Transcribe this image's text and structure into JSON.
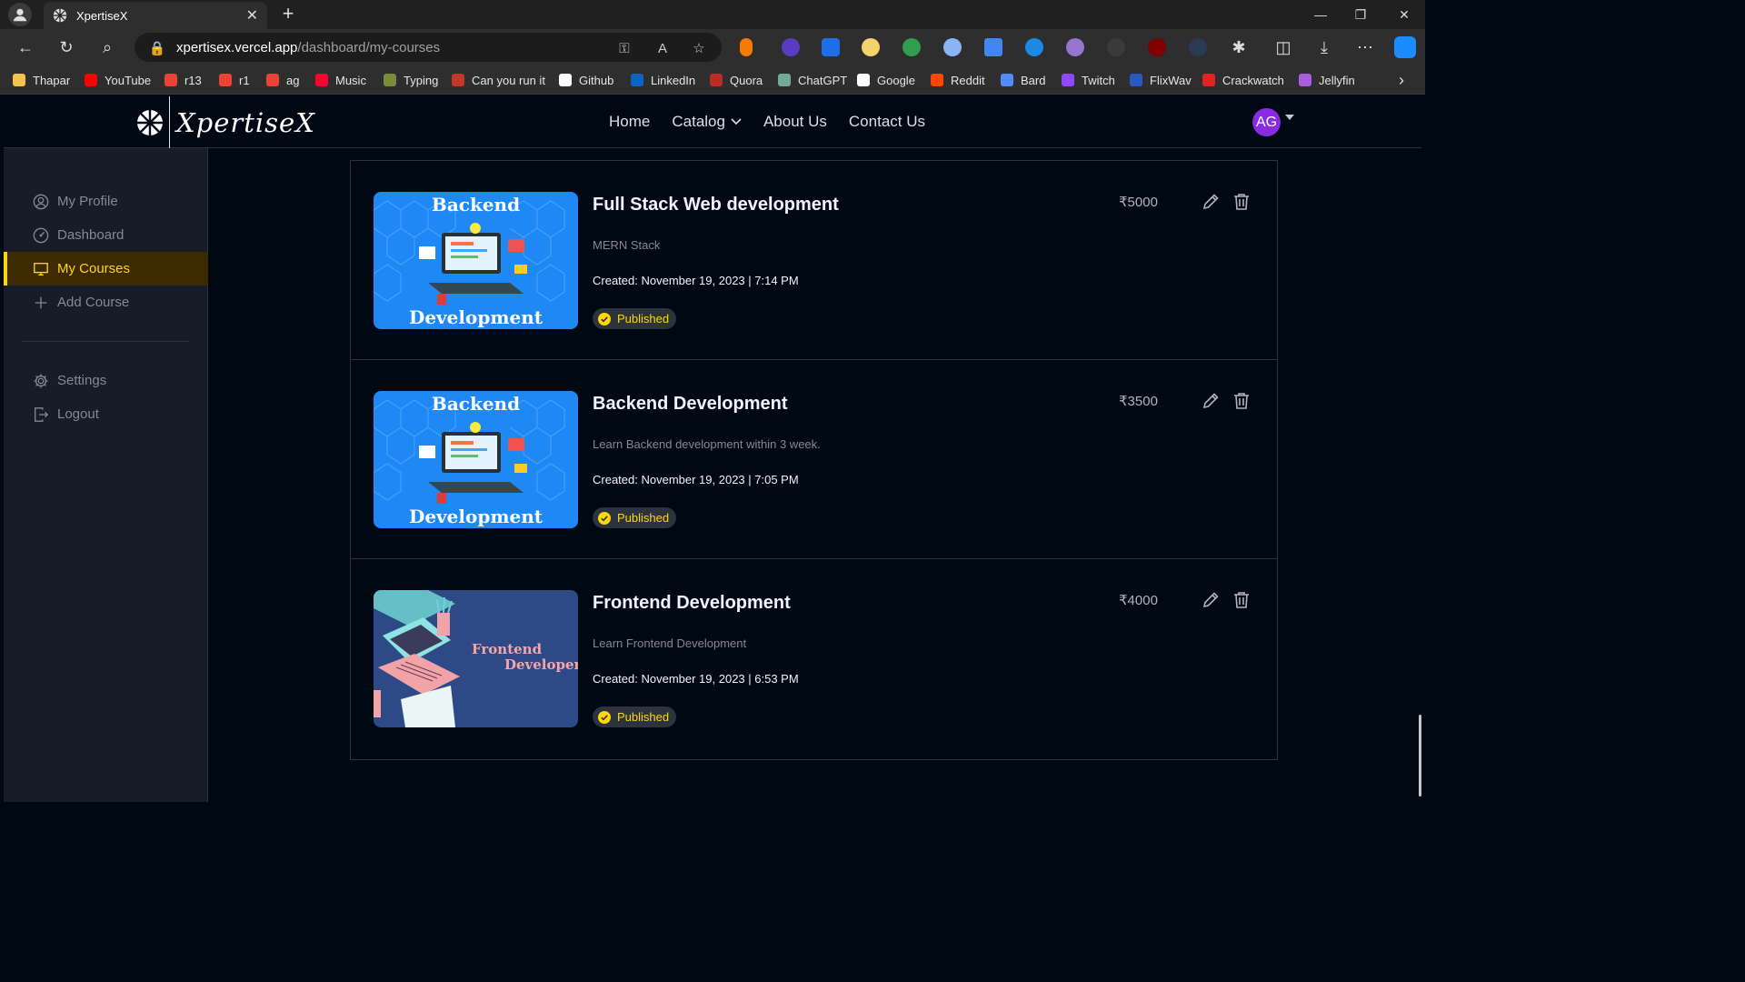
{
  "browser": {
    "tab_title": "XpertiseX",
    "url_host": "xpertisex.vercel.app",
    "url_path": "/dashboard/my-courses",
    "bookmarks": [
      {
        "label": "Thapar",
        "color": "#f2c14e"
      },
      {
        "label": "YouTube",
        "color": "#ff0000"
      },
      {
        "label": "r13",
        "color": "#ea4335"
      },
      {
        "label": "r1",
        "color": "#ea4335"
      },
      {
        "label": "ag",
        "color": "#ea4335"
      },
      {
        "label": "Music",
        "color": "#ff0033"
      },
      {
        "label": "Typing",
        "color": "#7a8c3a"
      },
      {
        "label": "Can you run it",
        "color": "#c0392b"
      },
      {
        "label": "Github",
        "color": "#ffffff"
      },
      {
        "label": "LinkedIn",
        "color": "#0a66c2"
      },
      {
        "label": "Quora",
        "color": "#b92b27"
      },
      {
        "label": "ChatGPT",
        "color": "#74aa9c"
      },
      {
        "label": "Google",
        "color": "#ffffff"
      },
      {
        "label": "Reddit",
        "color": "#ff4500"
      },
      {
        "label": "Bard",
        "color": "#4e8cff"
      },
      {
        "label": "Twitch",
        "color": "#9146ff"
      },
      {
        "label": "FlixWav",
        "color": "#2b59c3"
      },
      {
        "label": "Crackwatch",
        "color": "#e02424"
      },
      {
        "label": "Jellyfin",
        "color": "#a95ce0"
      }
    ]
  },
  "site": {
    "logo_text": "XpertiseX",
    "nav": {
      "home": "Home",
      "catalog": "Catalog",
      "about": "About Us",
      "contact": "Contact Us"
    },
    "avatar_initials": "AG"
  },
  "sidebar": {
    "items": [
      {
        "label": "My Profile"
      },
      {
        "label": "Dashboard"
      },
      {
        "label": "My Courses"
      },
      {
        "label": "Add Course"
      }
    ],
    "settings": "Settings",
    "logout": "Logout"
  },
  "courses": [
    {
      "title": "Full Stack Web development",
      "description": "MERN Stack",
      "created": "Created: November 19, 2023 | 7:14 PM",
      "status": "Published",
      "price": "₹5000",
      "thumb_top": "Backend",
      "thumb_bottom": "Development"
    },
    {
      "title": "Backend Development",
      "description": "Learn Backend development within 3 week.",
      "created": "Created: November 19, 2023 | 7:05 PM",
      "status": "Published",
      "price": "₹3500",
      "thumb_top": "Backend",
      "thumb_bottom": "Development"
    },
    {
      "title": "Frontend Development",
      "description": "Learn Frontend Development",
      "created": "Created: November 19, 2023 | 6:53 PM",
      "status": "Published",
      "price": "₹4000",
      "thumb_top": "Frontend",
      "thumb_bottom": "Developer"
    }
  ],
  "colors": {
    "accent": "#ffd60a",
    "background": "#000814",
    "sidebar": "#161d29"
  }
}
